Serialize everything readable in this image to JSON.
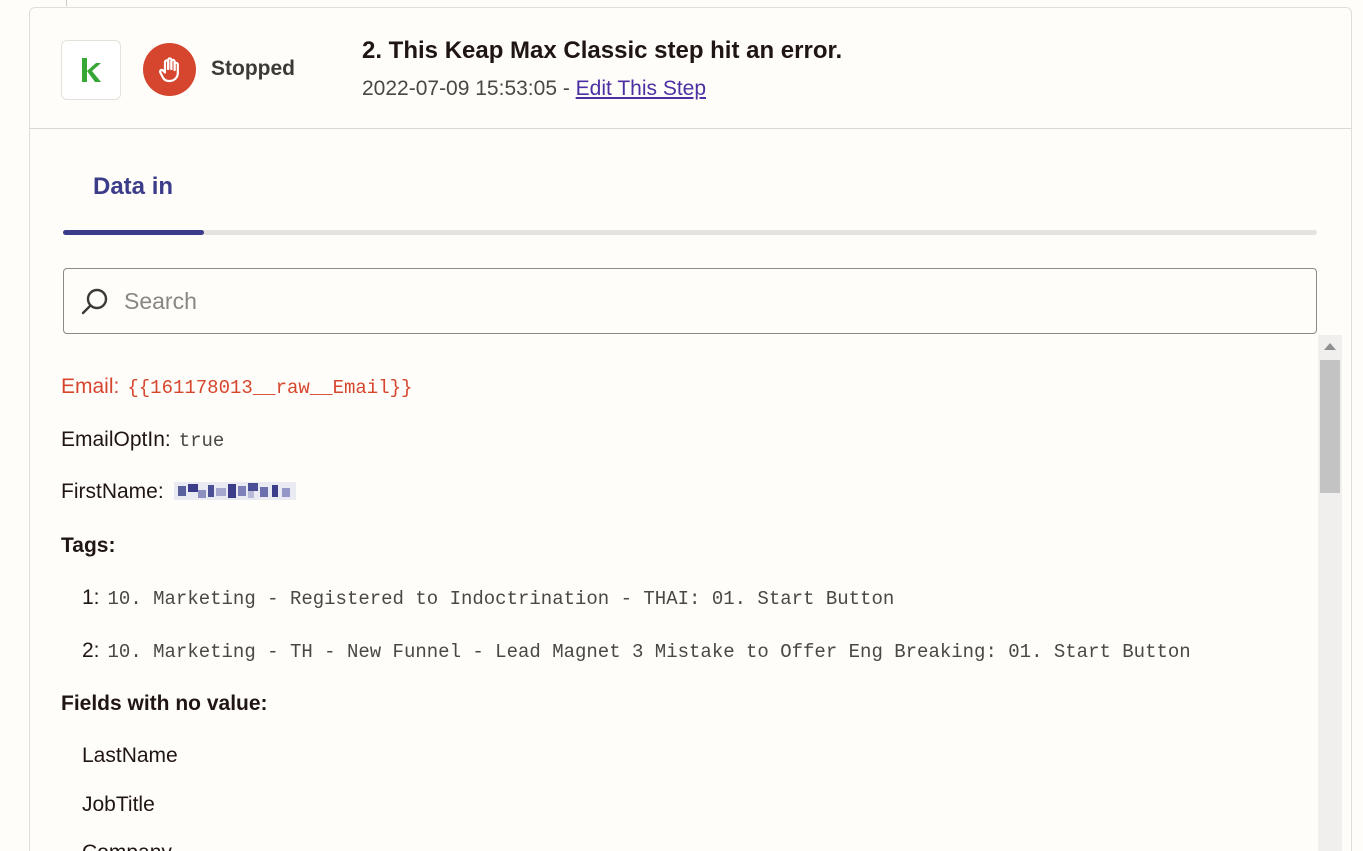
{
  "header": {
    "app_icon": "keap-logo-icon",
    "status_icon": "stop-hand-icon",
    "status_label": "Stopped",
    "title": "2. This Keap Max Classic step hit an error.",
    "timestamp": "2022-07-09 15:53:05",
    "separator": " - ",
    "edit_link": "Edit This Step"
  },
  "tabs": [
    {
      "label": "Data in",
      "active": true
    }
  ],
  "search": {
    "placeholder": "Search",
    "value": ""
  },
  "fields": {
    "email": {
      "key": "Email:",
      "value": "{{161178013__raw__Email}}"
    },
    "email_opt_in": {
      "key": "EmailOptIn:",
      "value": "true"
    },
    "first_name": {
      "key": "FirstName:"
    },
    "tags": {
      "key": "Tags:",
      "items": [
        {
          "index": "1:",
          "value": "10. Marketing - Registered to Indoctrination - THAI: 01. Start Button"
        },
        {
          "index": "2:",
          "value": "10. Marketing - TH - New Funnel - Lead Magnet 3 Mistake to Offer Eng Breaking: 01. Start Button"
        }
      ]
    },
    "no_value": {
      "label": "Fields with no value:",
      "items": [
        "LastName",
        "JobTitle",
        "Company"
      ]
    }
  },
  "colors": {
    "error": "#d6462e",
    "accent": "#3c3d8a",
    "link": "#4b2fa3",
    "keap_green": "#36a635"
  }
}
